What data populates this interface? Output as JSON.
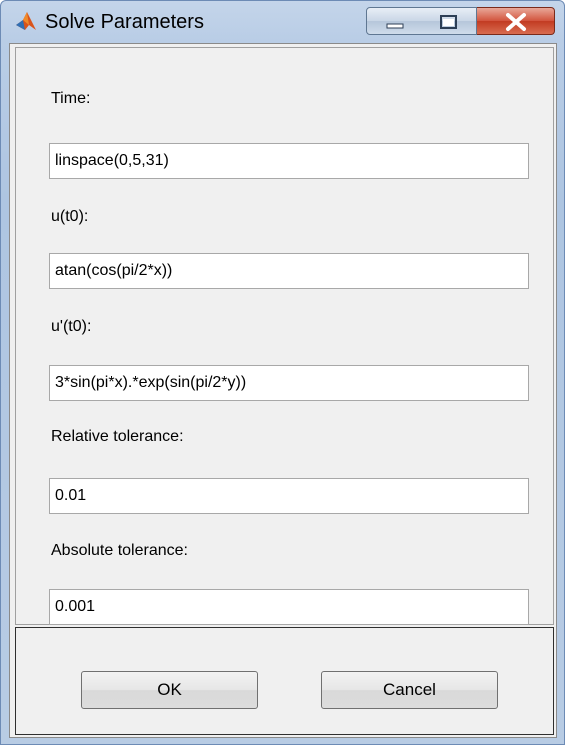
{
  "window": {
    "title": "Solve Parameters",
    "icon": "matlab-logo-icon",
    "controls": [
      "minimize-icon",
      "maximize-icon",
      "close-icon"
    ]
  },
  "fields": [
    {
      "label": "Time:",
      "value": "linspace(0,5,31)"
    },
    {
      "label": "u(t0):",
      "value": "atan(cos(pi/2*x))"
    },
    {
      "label": "u'(t0):",
      "value": "3*sin(pi*x).*exp(sin(pi/2*y))"
    },
    {
      "label": "Relative tolerance:",
      "value": "0.01"
    },
    {
      "label": "Absolute tolerance:",
      "value": "0.001"
    }
  ],
  "buttons": {
    "ok_label": "OK",
    "cancel_label": "Cancel"
  },
  "colors": {
    "titlebar": "#b9cde6",
    "close_button": "#c23b22",
    "dialog_background": "#f0f0f0"
  }
}
